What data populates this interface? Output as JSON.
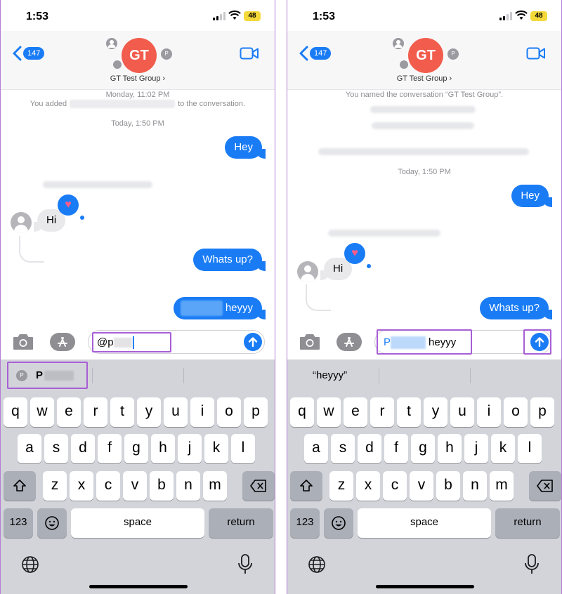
{
  "status": {
    "time": "1:53",
    "battery": "48"
  },
  "header": {
    "back_count": "147",
    "avatar_initials": "GT",
    "mini_avatar": "P",
    "group_name": "GT Test Group"
  },
  "left": {
    "sys_date": "Monday, 11:02 PM",
    "sys_added_prefix": "You added",
    "sys_added_suffix": "to the conversation.",
    "sys_today": "Today, 1:50 PM",
    "msg_hey": "Hey",
    "msg_hi": "Hi",
    "msg_whats_up": "Whats up?",
    "msg_heyyy": "heyyy",
    "field_text": "@p",
    "suggestion_avatar": "P",
    "suggestion_name": "P"
  },
  "right": {
    "sys_named": "You named the conversation “GT Test Group”.",
    "sys_today": "Today, 1:50 PM",
    "msg_hey": "Hey",
    "msg_hi": "Hi",
    "msg_whats_up": "Whats up?",
    "field_mention": "P",
    "field_text": "heyyy",
    "suggestion": "“heyyy”"
  },
  "keyboard": {
    "row1": [
      "q",
      "w",
      "e",
      "r",
      "t",
      "y",
      "u",
      "i",
      "o",
      "p"
    ],
    "row2": [
      "a",
      "s",
      "d",
      "f",
      "g",
      "h",
      "j",
      "k",
      "l"
    ],
    "row3": [
      "z",
      "x",
      "c",
      "v",
      "b",
      "n",
      "m"
    ],
    "numbers": "123",
    "space": "space",
    "return": "return"
  },
  "colors": {
    "accent": "#1a7cf5",
    "avatar": "#f25c4c",
    "highlight": "#a85fd6",
    "heart": "#ff5a8a"
  }
}
